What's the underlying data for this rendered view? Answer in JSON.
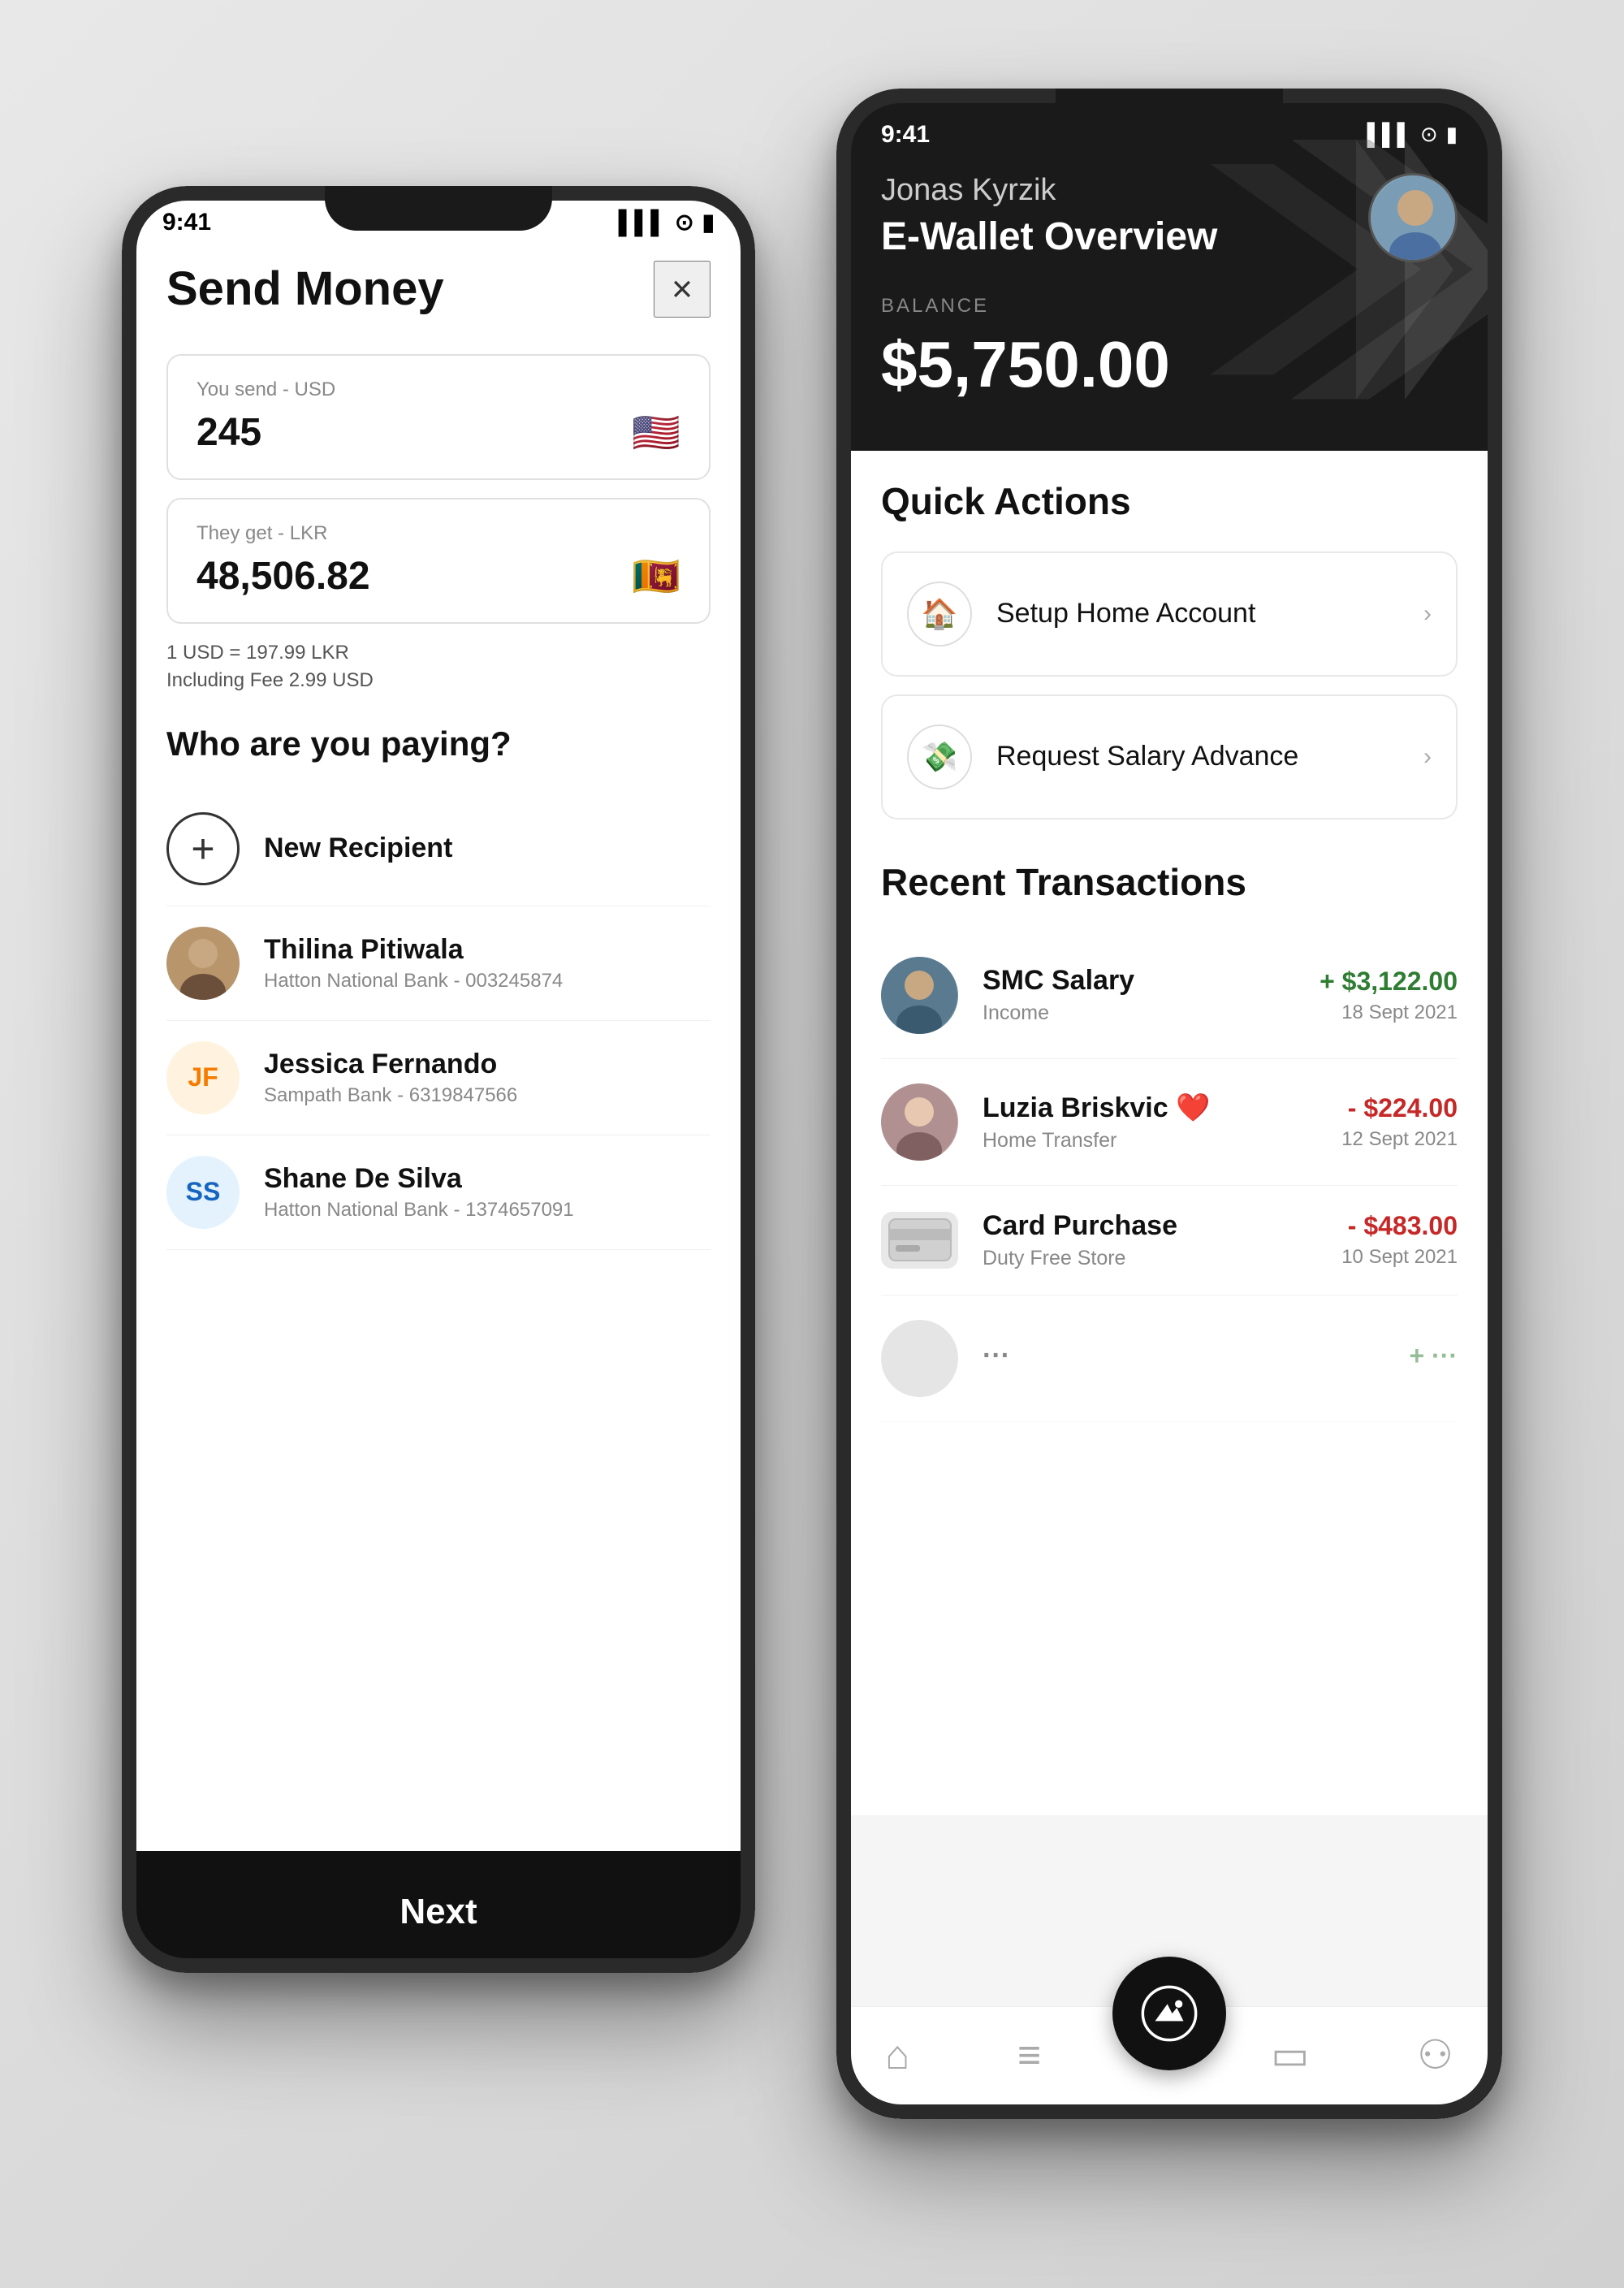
{
  "left_phone": {
    "status_time": "9:41",
    "title": "Send Money",
    "close_label": "×",
    "send_field": {
      "label": "You send - USD",
      "amount": "245",
      "flag": "🇺🇸"
    },
    "receive_field": {
      "label": "They get - LKR",
      "amount": "48,506.82",
      "flag": "🇱🇰"
    },
    "rate_line1": "1 USD = 197.99 LKR",
    "rate_line2": "Including Fee 2.99 USD",
    "who_paying": "Who are you paying?",
    "new_recipient_label": "New Recipient",
    "recipients": [
      {
        "initials": "",
        "name": "Thilina Pitiwala",
        "bank": "Hatton National Bank - 003245874",
        "avatar_type": "photo",
        "color": "#c8a882"
      },
      {
        "initials": "JF",
        "name": "Jessica Fernando",
        "bank": "Sampath Bank - 6319847566",
        "avatar_type": "initials",
        "color": "#fff3e0",
        "text_color": "#f57c00"
      },
      {
        "initials": "SS",
        "name": "Shane De Silva",
        "bank": "Hatton National Bank - 1374657091",
        "avatar_type": "initials",
        "color": "#e3f2fd",
        "text_color": "#1565c0"
      }
    ],
    "next_btn": "Next"
  },
  "right_phone": {
    "status_time": "9:41",
    "user_name": "Jonas Kyrzik",
    "wallet_title": "E-Wallet Overview",
    "balance_label": "BALANCE",
    "balance": "$5,750.00",
    "quick_actions_title": "Quick Actions",
    "quick_actions": [
      {
        "icon": "🏠",
        "label": "Setup Home Account"
      },
      {
        "icon": "💸",
        "label": "Request Salary Advance"
      }
    ],
    "recent_title": "Recent Transactions",
    "transactions": [
      {
        "name": "SMC Salary",
        "sub": "Income",
        "amount": "+ $3,122.00",
        "date": "18 Sept 2021",
        "type": "positive",
        "avatar_type": "photo",
        "color": "#6b8fa3"
      },
      {
        "name": "Luzia Briskvic ❤️",
        "sub": "Home Transfer",
        "amount": "- $224.00",
        "date": "12 Sept 2021",
        "type": "negative",
        "avatar_type": "photo",
        "color": "#c8a0a0"
      },
      {
        "name": "Card Purchase",
        "sub": "Duty Free Store",
        "amount": "- $483.00",
        "date": "10 Sept 2021",
        "type": "negative",
        "avatar_type": "card",
        "color": "#e0e0e0"
      },
      {
        "name": "...",
        "sub": "",
        "amount": "+ ...",
        "date": "",
        "type": "positive",
        "avatar_type": "partial",
        "color": "#ddd"
      }
    ],
    "nav_items": [
      "home",
      "menu",
      "card",
      "profile"
    ],
    "fab_icon": "🎯"
  }
}
